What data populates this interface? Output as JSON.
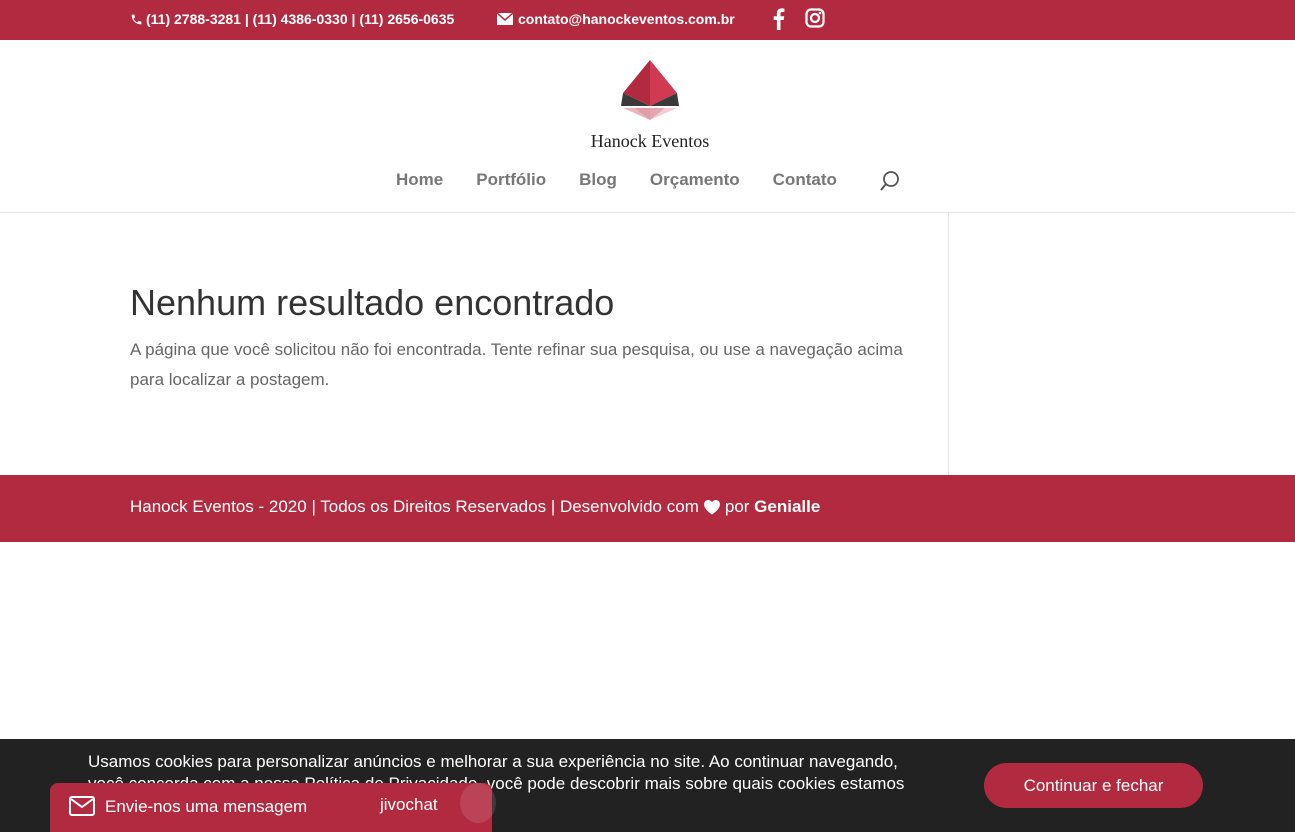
{
  "topbar": {
    "phones": "(11) 2788-3281 | (11) 4386-0330 | (11) 2656-0635",
    "email": "contato@hanockeventos.com.br",
    "social": [
      "facebook-icon",
      "instagram-icon"
    ]
  },
  "header": {
    "logo_text": "Hanock Eventos",
    "nav": [
      "Home",
      "Portfólio",
      "Blog",
      "Orçamento",
      "Contato"
    ]
  },
  "main": {
    "title": "Nenhum resultado encontrado",
    "message": "A página que você solicitou não foi encontrada. Tente refinar sua pesquisa, ou use a navegação acima para localizar a postagem."
  },
  "footer": {
    "text_before": "Hanock Eventos - 2020 | Todos os Direitos Reservados | Desenvolvido com",
    "text_por": "por",
    "brand": "Genialle"
  },
  "cookie": {
    "text": "Usamos cookies para personalizar anúncios e melhorar a sua experiência no site. Ao continuar navegando, você concorda com a nossa Política de Privacidade, você pode descobrir mais sobre quais cookies estamos",
    "button": "Continuar e fechar"
  },
  "chat": {
    "label": "Envie-nos uma mensagem",
    "brand": "jivochat"
  },
  "colors": {
    "brand": "#b22a40",
    "cookie_bg": "#222222"
  }
}
